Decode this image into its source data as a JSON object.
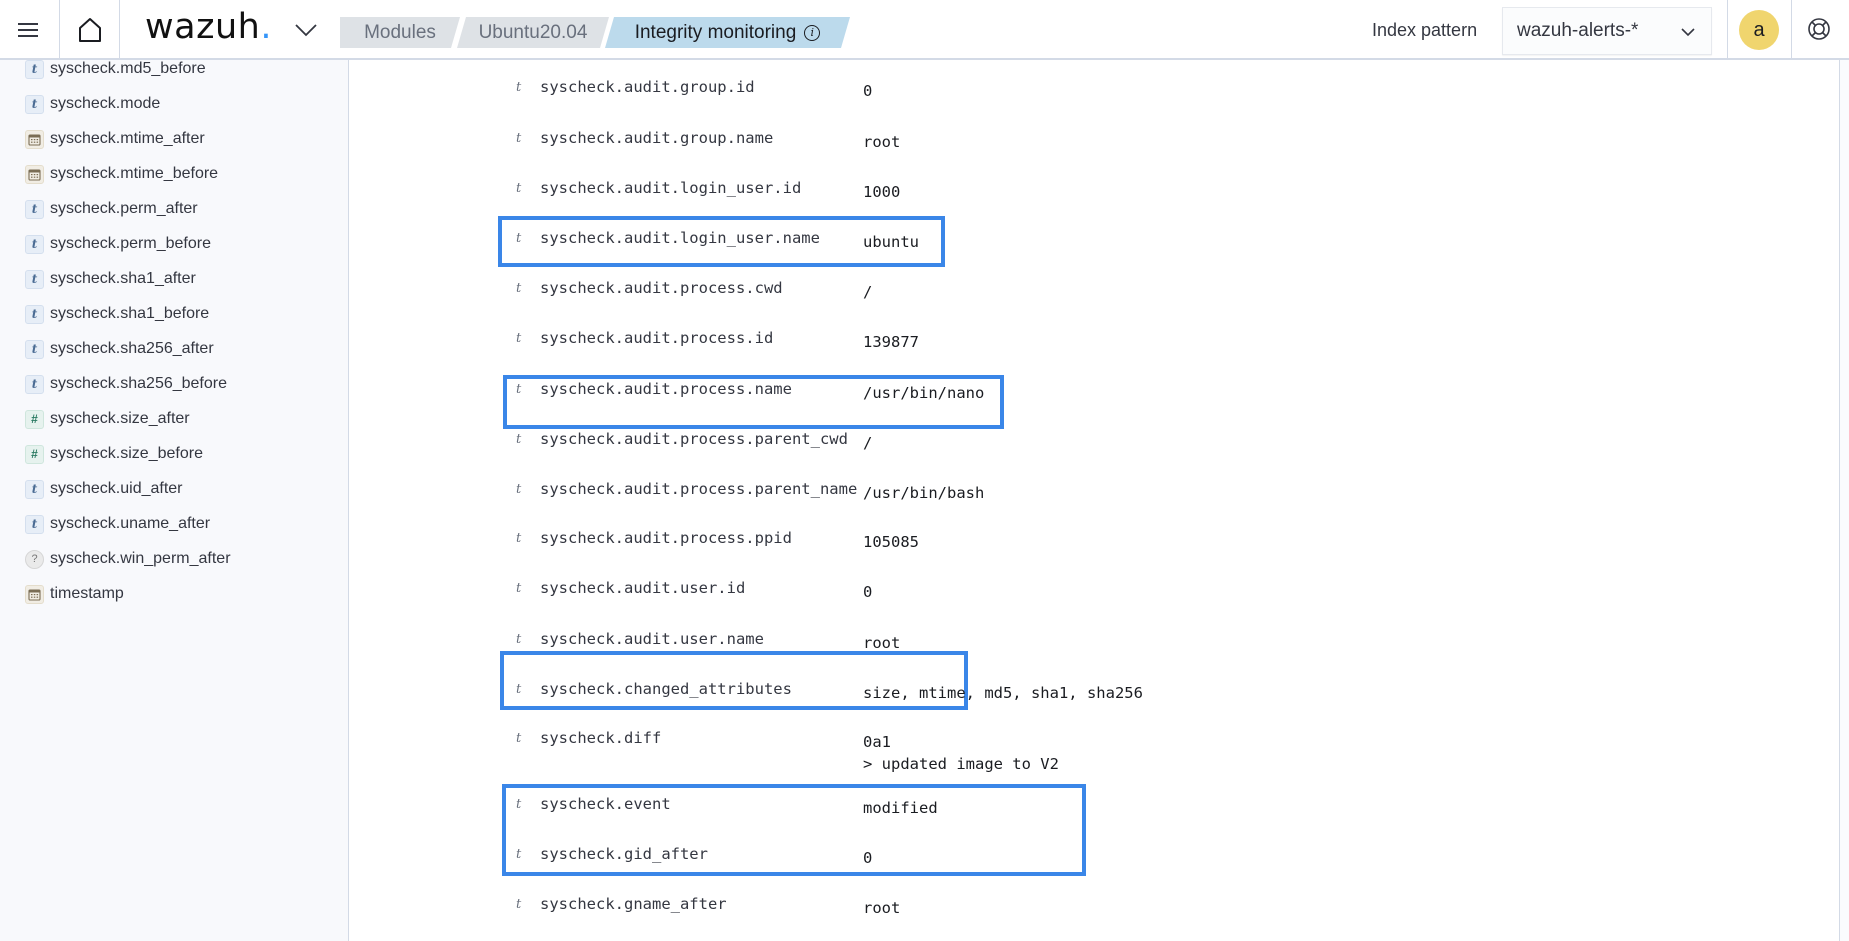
{
  "header": {
    "menu_icon": "hamburger-menu-icon",
    "home_icon": "home-icon",
    "logo_text": "wazuh",
    "logo_dot": ".",
    "logo_dot_color": "#3595f9",
    "breadcrumbs": [
      {
        "label": "Modules"
      },
      {
        "label": "Ubuntu20.04"
      },
      {
        "label": "Integrity monitoring",
        "info_icon": "i"
      }
    ],
    "index_pattern_label": "Index pattern",
    "index_pattern_value": "wazuh-alerts-*",
    "avatar_initial": "a",
    "avatar_color": "#f0d56e",
    "help_icon": "help-lifebuoy-icon"
  },
  "sidebar": {
    "fields": [
      {
        "type": "t",
        "name": "syscheck.md5_before"
      },
      {
        "type": "t",
        "name": "syscheck.mode"
      },
      {
        "type": "date",
        "name": "syscheck.mtime_after"
      },
      {
        "type": "date",
        "name": "syscheck.mtime_before"
      },
      {
        "type": "t",
        "name": "syscheck.perm_after"
      },
      {
        "type": "t",
        "name": "syscheck.perm_before"
      },
      {
        "type": "t",
        "name": "syscheck.sha1_after"
      },
      {
        "type": "t",
        "name": "syscheck.sha1_before"
      },
      {
        "type": "t",
        "name": "syscheck.sha256_after"
      },
      {
        "type": "t",
        "name": "syscheck.sha256_before"
      },
      {
        "type": "#",
        "name": "syscheck.size_after"
      },
      {
        "type": "#",
        "name": "syscheck.size_before"
      },
      {
        "type": "t",
        "name": "syscheck.uid_after"
      },
      {
        "type": "t",
        "name": "syscheck.uname_after"
      },
      {
        "type": "?",
        "name": "syscheck.win_perm_after"
      },
      {
        "type": "date",
        "name": "timestamp"
      }
    ]
  },
  "document": {
    "highlight_color": "#3a86e8",
    "rows": [
      {
        "type": "t",
        "field": "syscheck.audit.group.id",
        "value": "0"
      },
      {
        "type": "t",
        "field": "syscheck.audit.group.name",
        "value": "root"
      },
      {
        "type": "t",
        "field": "syscheck.audit.login_user.id",
        "value": "1000"
      },
      {
        "type": "t",
        "field": "syscheck.audit.login_user.name",
        "value": "ubuntu",
        "highlighted": true
      },
      {
        "type": "t",
        "field": "syscheck.audit.process.cwd",
        "value": "/"
      },
      {
        "type": "t",
        "field": "syscheck.audit.process.id",
        "value": "139877"
      },
      {
        "type": "t",
        "field": "syscheck.audit.process.name",
        "value": "/usr/bin/nano",
        "highlighted": true
      },
      {
        "type": "t",
        "field": "syscheck.audit.process.parent_cwd",
        "value": "/"
      },
      {
        "type": "t",
        "field": "syscheck.audit.process.parent_name",
        "value": "/usr/bin/bash"
      },
      {
        "type": "t",
        "field": "syscheck.audit.process.ppid",
        "value": "105085"
      },
      {
        "type": "t",
        "field": "syscheck.audit.user.id",
        "value": "0"
      },
      {
        "type": "t",
        "field": "syscheck.audit.user.name",
        "value": "root",
        "highlighted": true
      },
      {
        "type": "t",
        "field": "syscheck.changed_attributes",
        "value": "size, mtime, md5, sha1, sha256"
      },
      {
        "type": "t",
        "field": "syscheck.diff",
        "value": "0a1\n> updated image to V2",
        "highlighted": true
      },
      {
        "type": "t",
        "field": "syscheck.event",
        "value": "modified"
      },
      {
        "type": "t",
        "field": "syscheck.gid_after",
        "value": "0"
      },
      {
        "type": "t",
        "field": "syscheck.gname_after",
        "value": "root"
      }
    ]
  }
}
